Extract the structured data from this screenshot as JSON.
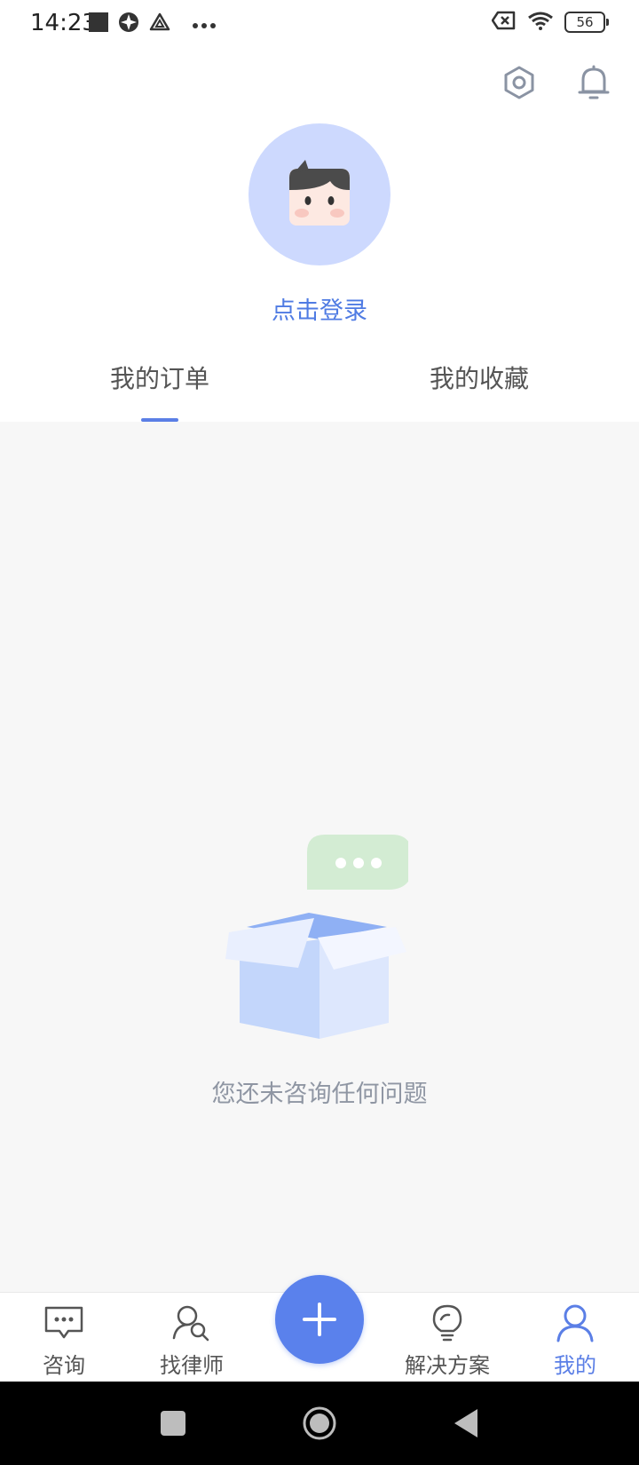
{
  "status_bar": {
    "time": "14:23",
    "battery": "56",
    "icons": [
      "notification-square-icon",
      "app-icon",
      "app-icon-2",
      "more-dots-icon",
      "sim-off-icon",
      "wifi-icon",
      "battery-icon"
    ]
  },
  "header": {
    "settings_icon": "gear-icon",
    "notifications_icon": "bell-icon"
  },
  "profile": {
    "login_text": "点击登录",
    "avatar_icon": "default-avatar-icon"
  },
  "tabs": [
    {
      "label": "我的订单",
      "active": true
    },
    {
      "label": "我的收藏",
      "active": false
    }
  ],
  "empty_state": {
    "message": "您还未咨询任何问题",
    "illustration": "empty-box-with-chat-bubble"
  },
  "bottom_nav": {
    "items": [
      {
        "label": "咨询",
        "icon": "chat-icon",
        "active": false
      },
      {
        "label": "找律师",
        "icon": "find-lawyer-icon",
        "active": false
      },
      {
        "label": "解决方案",
        "icon": "lightbulb-icon",
        "active": false
      },
      {
        "label": "我的",
        "icon": "user-icon",
        "active": true
      }
    ],
    "fab_icon": "plus-icon"
  },
  "colors": {
    "accent": "#5a81ec",
    "login_text": "#4f7be3",
    "avatar_bg": "#cdd9fe",
    "content_bg": "#f7f7f7",
    "empty_text": "#8f96a3"
  }
}
